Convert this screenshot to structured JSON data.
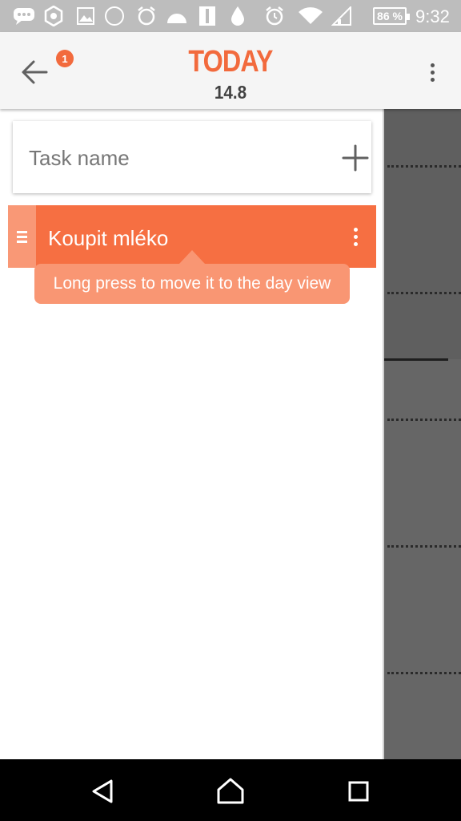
{
  "status_bar": {
    "icons": [
      "chat-icon",
      "settings-icon",
      "image-icon",
      "speedometer-icon",
      "alarm-clock-icon",
      "weather-icon",
      "sim-icon",
      "water-drop-icon",
      "alarm-icon",
      "wifi-icon",
      "signal-icon"
    ],
    "battery": "86 %",
    "time": "9:32",
    "color": "#bdbdbd"
  },
  "app_bar": {
    "back_icon": "arrow-left-icon",
    "badge_count": "1",
    "title": "TODAY",
    "subtitle": "14.8",
    "menu_icon": "more-vertical-icon",
    "accent_color": "#f26a3d"
  },
  "task_input": {
    "placeholder": "Task name",
    "value": "",
    "add_icon": "plus-icon"
  },
  "tasks": [
    {
      "label": "Koupit mléko",
      "handle_icon": "drag-handle-icon",
      "menu_icon": "more-vertical-icon",
      "color": "#f66f42"
    }
  ],
  "tooltip": {
    "text": "Long press to move it to the day view"
  },
  "nav_bar": {
    "back_icon": "triangle-back-icon",
    "home_icon": "home-icon",
    "recents_icon": "square-recents-icon"
  }
}
